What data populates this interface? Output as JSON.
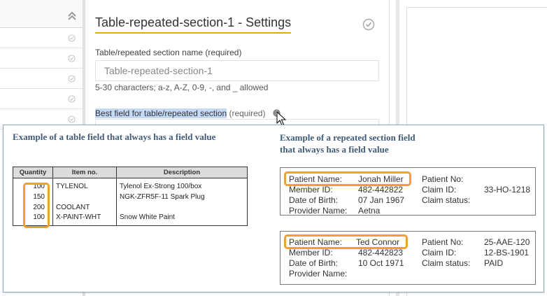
{
  "settings": {
    "title": "Table-repeated-section-1 - Settings",
    "name_label": "Table/repeated section name (required)",
    "name_value": "Table-repeated-section-1",
    "name_hint": "5-30 characters; a-z, A-Z, 0-9, -, and _ allowed",
    "best_field_label": "Best field for table/repeated section",
    "best_field_required": " (required)"
  },
  "tooltip": {
    "table_example_title": "Example of a table field that always has a field value",
    "repeated_example_title_line1": "Example of a repeated section field",
    "repeated_example_title_line2": "that always has a field value",
    "table": {
      "headers": [
        "Quantity",
        "Item no.",
        "Description"
      ],
      "rows": [
        [
          "100",
          "TYLENOL",
          "Tylenol Ex-Strong 100/box"
        ],
        [
          "150",
          "",
          "NGK-ZFR5F-11 Spark Plug"
        ],
        [
          "200",
          "COOLANT",
          ""
        ],
        [
          "100",
          "X-PAINT-WHT",
          "Snow White Paint"
        ]
      ]
    },
    "patients": [
      {
        "patient_name_label": "Patient Name:",
        "patient_name": "Jonah Miller",
        "member_id_label": "Member ID:",
        "member_id": "482-442822",
        "dob_label": "Date of Birth:",
        "dob": "07 Jan 1967",
        "provider_label": "Provider Name:",
        "provider": "Aetna",
        "patient_no_label": "Patient No:",
        "patient_no": "",
        "claim_id_label": "Claim ID:",
        "claim_id": "33-HO-1218",
        "claim_status_label": "Claim status:",
        "claim_status": ""
      },
      {
        "patient_name_label": "Patient Name:",
        "patient_name": "Ted Connor",
        "member_id_label": "Member ID:",
        "member_id": "482-442823",
        "dob_label": "Date of Birth:",
        "dob": "10 Oct 1971",
        "provider_label": "Provider Name:",
        "provider": "",
        "patient_no_label": "Patient No:",
        "patient_no": "25-AAE-120",
        "claim_id_label": "Claim ID:",
        "claim_id": "12-BS-1901",
        "claim_status_label": "Claim status:",
        "claim_status": "PAID"
      }
    ]
  },
  "icons": {
    "collapse": "double-chevron-up-icon",
    "check": "check-circle-icon",
    "info": "info-icon",
    "cursor": "mouse-pointer-icon"
  },
  "colors": {
    "accent_underline": "#f0a500",
    "highlight_box": "#f0a030",
    "selection": "#c3d9f6",
    "tooltip_title": "#3f5a77",
    "tooltip_border": "#8fa7bd"
  }
}
